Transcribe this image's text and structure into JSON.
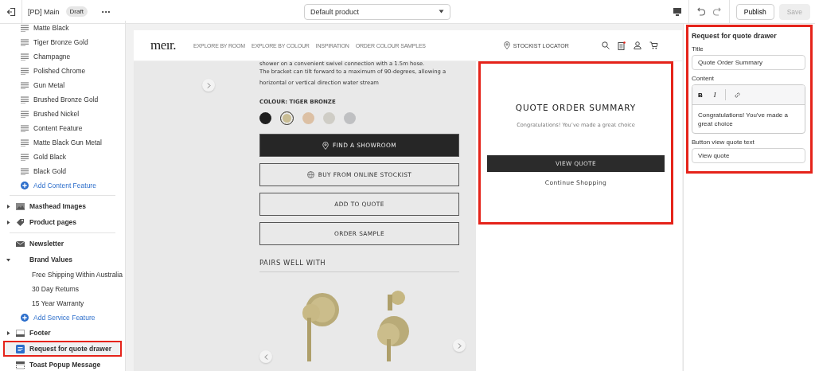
{
  "topbar": {
    "title": "[PD] Main",
    "badge": "Draft",
    "more": "•••",
    "template": "Default product",
    "buttons": [
      {
        "label": "Publish",
        "disabled": false
      },
      {
        "label": "Save",
        "disabled": true
      }
    ]
  },
  "sidebar": {
    "items": [
      {
        "kind": "block",
        "label": "Matte Black"
      },
      {
        "kind": "block",
        "label": "Tiger Bronze Gold"
      },
      {
        "kind": "block",
        "label": "Champagne"
      },
      {
        "kind": "block",
        "label": "Polished Chrome"
      },
      {
        "kind": "block",
        "label": "Gun Metal"
      },
      {
        "kind": "block",
        "label": "Brushed Bronze Gold"
      },
      {
        "kind": "block",
        "label": "Brushed Nickel"
      },
      {
        "kind": "block",
        "label": "Content Feature"
      },
      {
        "kind": "block",
        "label": "Matte Black Gun Metal"
      },
      {
        "kind": "block",
        "label": "Gold Black"
      },
      {
        "kind": "block",
        "label": "Black Gold"
      },
      {
        "kind": "add",
        "label": "Add Content Feature"
      },
      {
        "kind": "rule"
      },
      {
        "kind": "section",
        "label": "Masthead Images",
        "expanded": false,
        "selected": false,
        "highlighted": false
      },
      {
        "kind": "section",
        "label": "Product pages",
        "expanded": false,
        "selected": false,
        "highlighted": false
      },
      {
        "kind": "rule"
      },
      {
        "kind": "section",
        "label": "Newsletter",
        "selected": false,
        "highlighted": false
      },
      {
        "kind": "section",
        "label": "Brand Values",
        "expanded": true,
        "selected": false,
        "highlighted": false
      },
      {
        "kind": "child",
        "label": "Free Shipping Within Australia"
      },
      {
        "kind": "child",
        "label": "30 Day Returns"
      },
      {
        "kind": "child",
        "label": "15 Year Warranty"
      },
      {
        "kind": "add",
        "label": "Add Service Feature"
      },
      {
        "kind": "section",
        "label": "Footer",
        "expanded": false,
        "selected": false,
        "highlighted": false
      },
      {
        "kind": "section",
        "label": "Request for quote drawer",
        "selected": true,
        "highlighted": true
      },
      {
        "kind": "section",
        "label": "Toast Popup Message",
        "selected": false,
        "highlighted": false
      }
    ]
  },
  "preview": {
    "logo": "meır.",
    "nav": [
      "EXPLORE BY ROOM",
      "EXPLORE BY COLOUR",
      "INSPIRATION",
      "ORDER COLOUR SAMPLES"
    ],
    "stockist": "STOCKIST LOCATOR",
    "description": [
      "shower on a convenient swivel connection with a 1.5m hose.",
      "The bracket can tilt forward to a maximum of 90-degrees, allowing a horizontal or vertical direction water stream"
    ],
    "colour_label": "COLOUR: TIGER BRONZE",
    "swatches": [
      {
        "color": "#1e1e1e",
        "selected": false
      },
      {
        "color": "#c9bd94",
        "selected": true
      },
      {
        "color": "#dcc0a4",
        "selected": false
      },
      {
        "color": "#cfcdc6",
        "selected": false
      },
      {
        "color": "#bfc0c2",
        "selected": false
      }
    ],
    "buttons": [
      {
        "kind": "dark",
        "label": "FIND A SHOWROOM"
      },
      {
        "kind": "outline",
        "label": "BUY FROM ONLINE STOCKIST"
      },
      {
        "kind": "outline",
        "label": "ADD TO QUOTE"
      },
      {
        "kind": "outline",
        "label": "ORDER SAMPLE"
      }
    ],
    "pairs_heading": "PAIRS WELL WITH",
    "pairs": [
      {
        "kind": "picture"
      },
      {
        "kind": "picture"
      }
    ],
    "drawer": {
      "highlighted": true,
      "title": "QUOTE ORDER SUMMARY",
      "text": "Congratulations! You’ve made a great choice",
      "button": "VIEW QUOTE",
      "link": "Continue Shopping"
    }
  },
  "settings": {
    "highlighted": true,
    "heading": "Request for quote drawer",
    "fields": [
      {
        "kind": "text",
        "label": "Title",
        "value": "Quote Order Summary"
      },
      {
        "kind": "richtext",
        "label": "Content",
        "tools": [
          "B",
          "I"
        ],
        "value": "Congratulations! You’ve made a great choice"
      },
      {
        "kind": "text",
        "label": "Button view quote text",
        "value": "View quote"
      }
    ]
  }
}
